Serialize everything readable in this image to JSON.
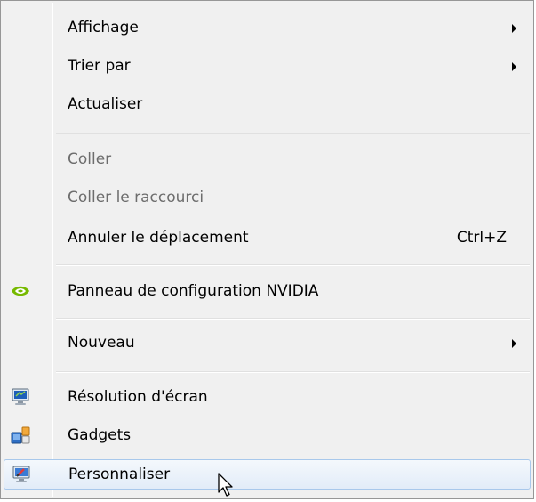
{
  "menu": {
    "items": [
      {
        "label": "Affichage",
        "submenu": true,
        "enabled": true
      },
      {
        "label": "Trier par",
        "submenu": true,
        "enabled": true
      },
      {
        "label": "Actualiser",
        "enabled": true
      },
      {
        "label": "Coller",
        "enabled": false
      },
      {
        "label": "Coller le raccourci",
        "enabled": false
      },
      {
        "label": "Annuler le déplacement",
        "shortcut": "Ctrl+Z",
        "enabled": true
      },
      {
        "label": "Panneau de configuration NVIDIA",
        "icon": "nvidia-icon",
        "enabled": true
      },
      {
        "label": "Nouveau",
        "submenu": true,
        "enabled": true
      },
      {
        "label": "Résolution d'écran",
        "icon": "display-icon",
        "enabled": true
      },
      {
        "label": "Gadgets",
        "icon": "gadgets-icon",
        "enabled": true
      },
      {
        "label": "Personnaliser",
        "icon": "personalize-icon",
        "enabled": true,
        "highlighted": true
      }
    ]
  },
  "colors": {
    "menu_background": "#f0f0f0",
    "disabled_text": "#6d6d6d",
    "highlight_border": "#a8c8eb",
    "nvidia_green": "#76b900"
  }
}
